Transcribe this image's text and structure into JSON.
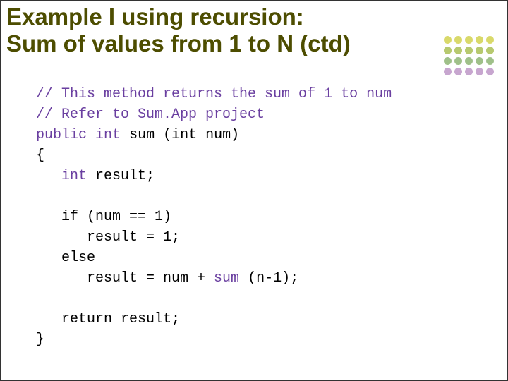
{
  "title_line1": "Example I using recursion:",
  "title_line2": "Sum of values from 1 to N (ctd)",
  "code": {
    "c1": "// This method returns the sum of 1 to num",
    "c2": "// Refer to Sum.App project",
    "kw_public": "public",
    "kw_int1": "int",
    "fn_name": "sum",
    "sig_rest": " (int num)",
    "brace_open": "{",
    "decl_int": "int",
    "decl_rest": " result;",
    "if_line": "if (num == 1)",
    "then_line": "result = 1;",
    "else_line": "else",
    "rec_prefix": "result = num + ",
    "rec_call": "sum",
    "rec_suffix": " (n-1);",
    "return_line": "return result;",
    "brace_close": "}"
  }
}
